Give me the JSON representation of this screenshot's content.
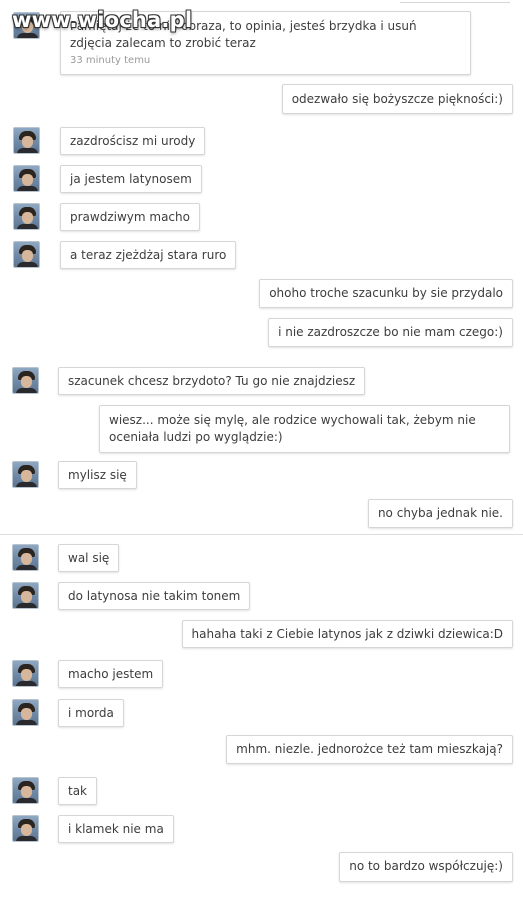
{
  "watermark": "www.wiocha.pl",
  "messages": [
    {
      "text": "Pamiętaj że to nie obraza, to opinia, jesteś brzydka i usuń zdjęcia zalecam to zrobić teraz",
      "time": "33 minuty temu"
    },
    {
      "text": "odezwało się bożyszcze piękności:)"
    },
    {
      "text": "zazdrościsz mi urody"
    },
    {
      "text": "ja jestem latynosem"
    },
    {
      "text": "prawdziwym macho"
    },
    {
      "text": "a teraz zjeżdżaj stara ruro"
    },
    {
      "text": "ohoho troche szacunku by sie przydalo"
    },
    {
      "text": "i nie zazdroszcze bo nie mam czego:)"
    },
    {
      "text": "szacunek chcesz brzydoto? Tu go nie znajdziesz"
    },
    {
      "text": "wiesz... może się mylę, ale rodzice wychowali tak, żebym nie oceniała ludzi po wyglądzie:)"
    },
    {
      "text": "mylisz się"
    },
    {
      "text": "no chyba jednak nie."
    },
    {
      "text": "wal się"
    },
    {
      "text": "do latynosa nie takim tonem"
    },
    {
      "text": "hahaha taki z Ciebie latynos jak z dziwki dziewica:D"
    },
    {
      "text": "macho jestem"
    },
    {
      "text": "i morda"
    },
    {
      "text": "mhm. niezle. jednorożce też tam mieszkają?"
    },
    {
      "text": "tak"
    },
    {
      "text": "i klamek nie ma"
    },
    {
      "text": "no to bardzo współczuję:)"
    }
  ]
}
